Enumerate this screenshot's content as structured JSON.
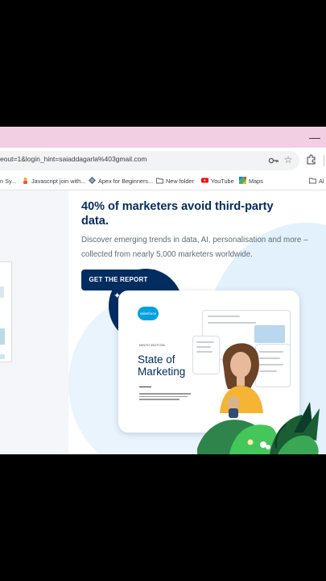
{
  "browser": {
    "url": "eout=1&login_hint=saiaddagarla%403gmail.com",
    "minimize_glyph": "—"
  },
  "bookmarks": [
    {
      "label": "n Sy...",
      "icon": "bookmark-fragment-icon"
    },
    {
      "label": "Javascript join with...",
      "icon": "javascript-icon"
    },
    {
      "label": "Apex for Beginners...",
      "icon": "apex-icon"
    },
    {
      "label": "New folder",
      "icon": "folder-icon"
    },
    {
      "label": "YouTube",
      "icon": "youtube-icon"
    },
    {
      "label": "Maps",
      "icon": "maps-icon"
    },
    {
      "label": "Al",
      "icon": "folder-icon"
    }
  ],
  "page": {
    "headline": "40% of marketers avoid third-party data.",
    "description": "Discover emerging trends in data, AI, personalisation and more – collected from nearly 5,000 marketers worldwide.",
    "cta_label": "GET THE REPORT"
  },
  "report": {
    "brand": "salesforce",
    "edition": "NINTH EDITION",
    "title_line1": "State of",
    "title_line2": "Marketing"
  },
  "colors": {
    "titlebar": "#f3cfe3",
    "navy": "#032d60",
    "salesforce_blue": "#00a1e0"
  }
}
